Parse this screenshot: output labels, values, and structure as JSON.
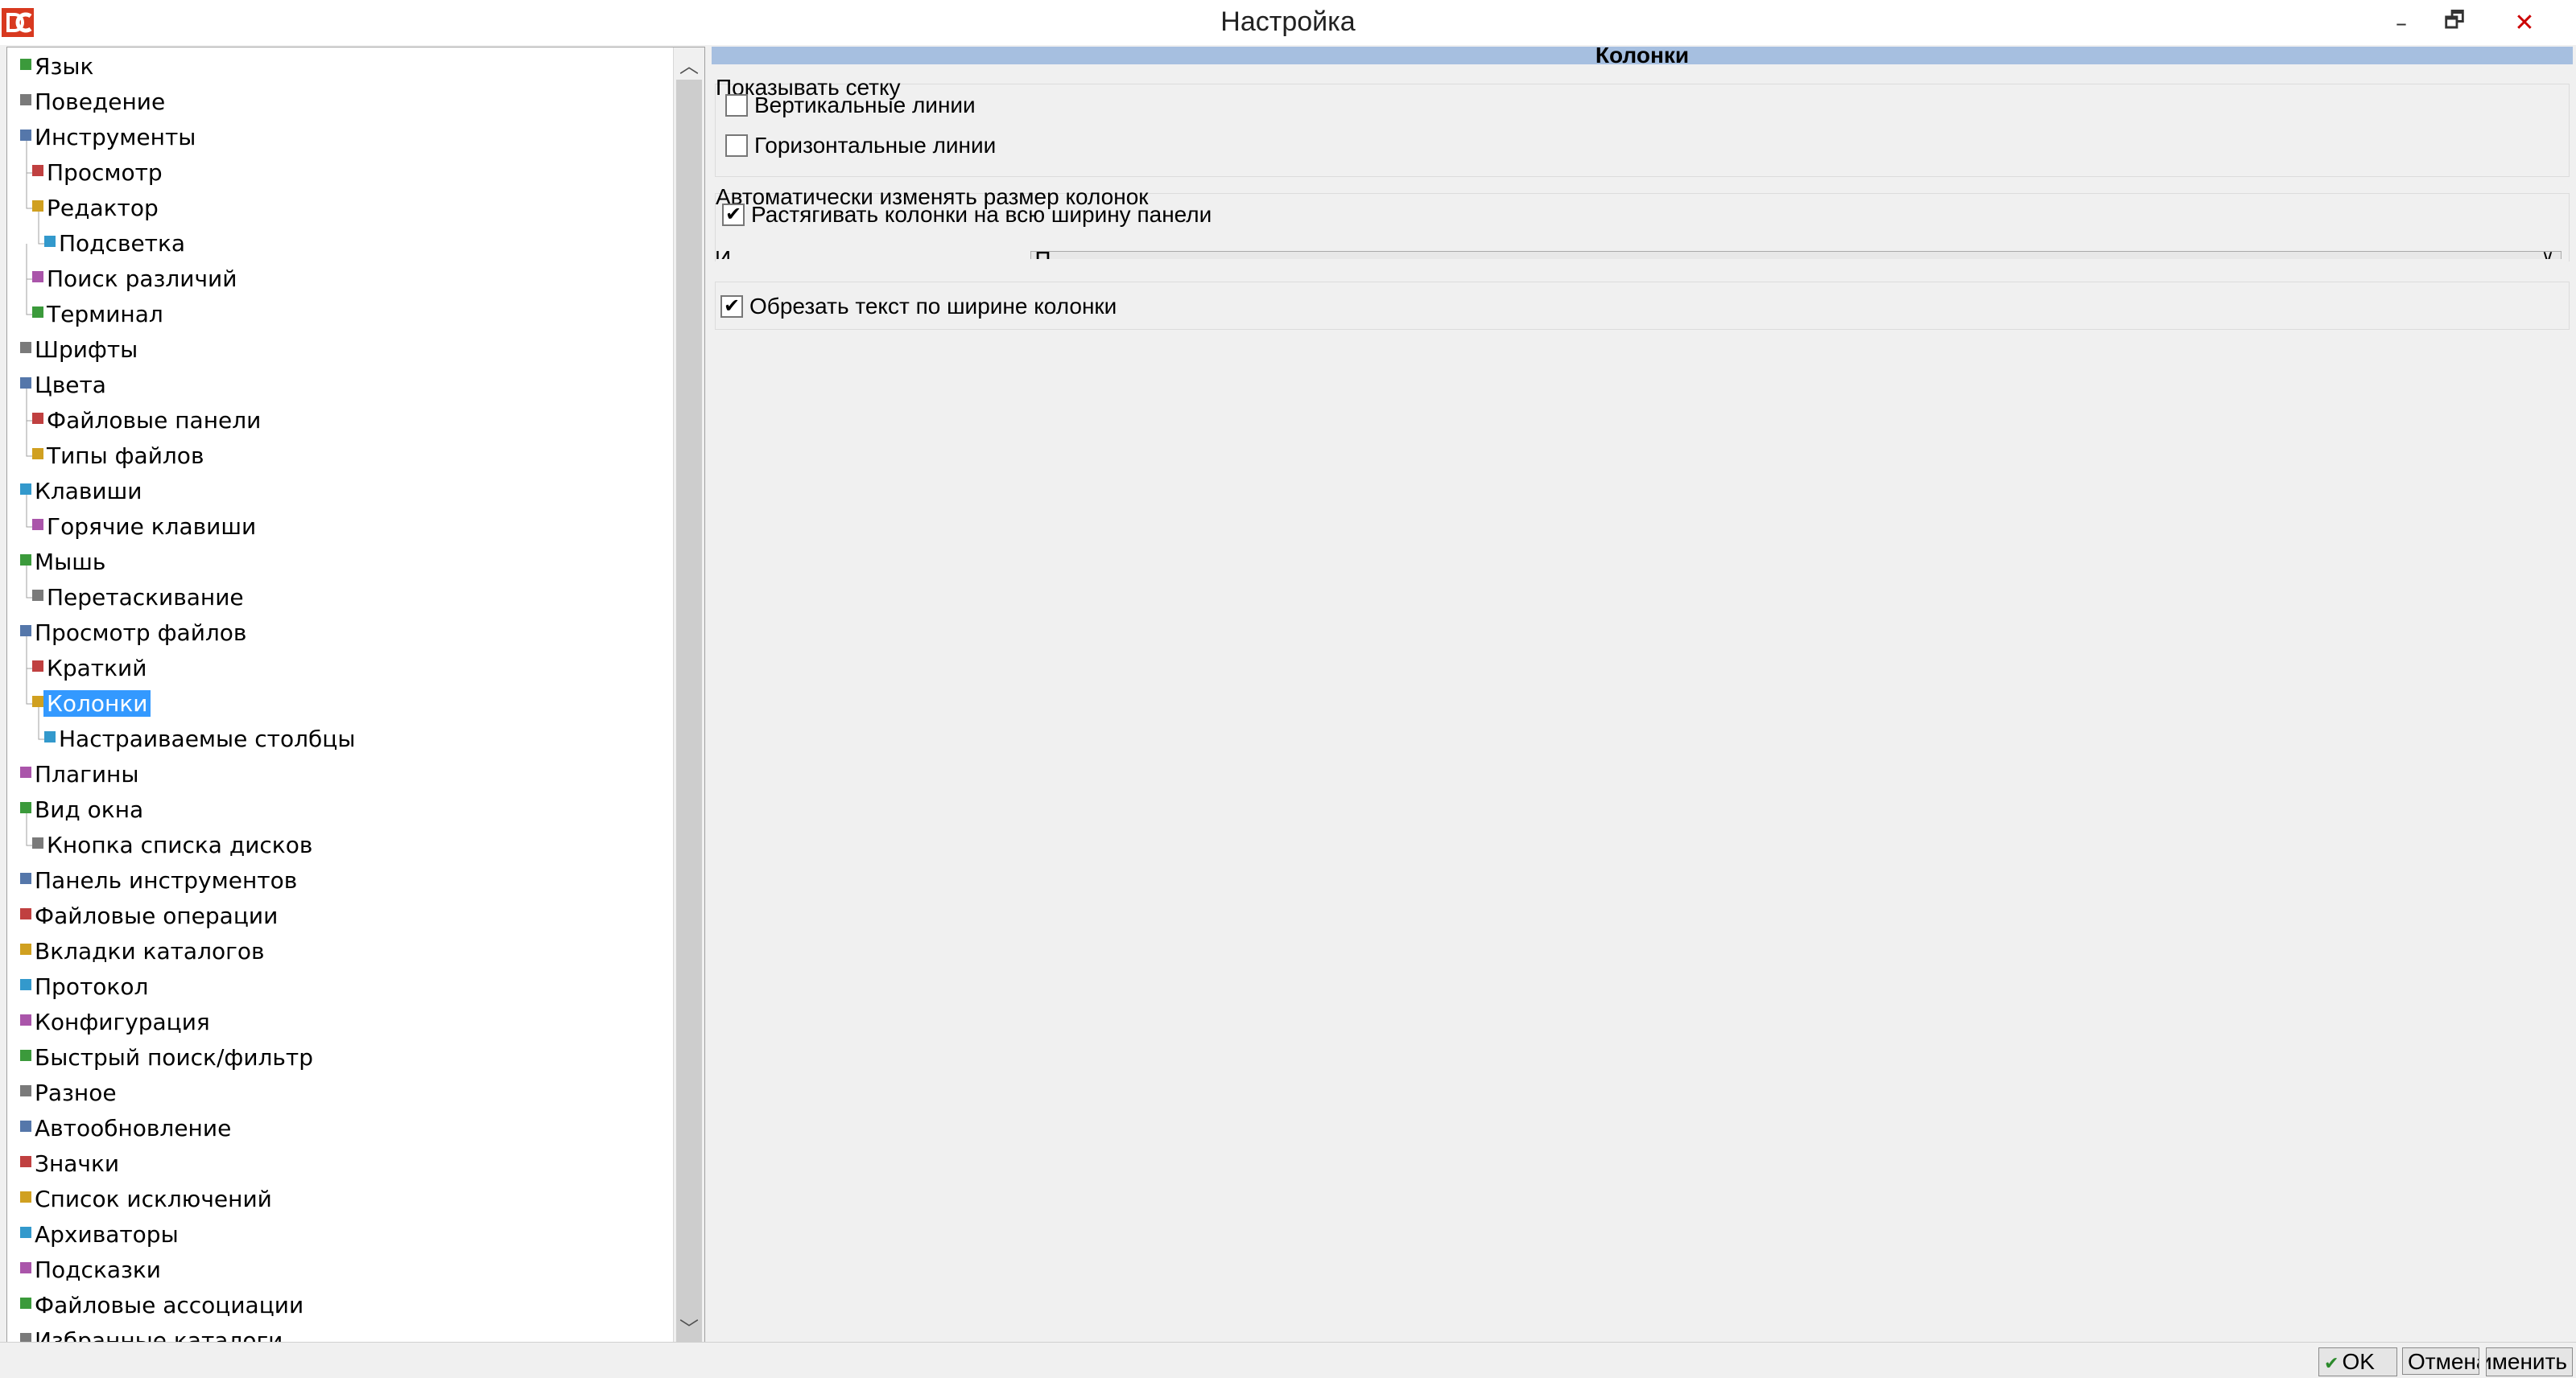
{
  "window": {
    "title": "Настройка",
    "minimize_glyph": "–",
    "restore_glyph": "🗗",
    "close_glyph": "✕"
  },
  "tree": {
    "selected": "Колонки",
    "items": [
      {
        "label": "Язык",
        "level": 0,
        "icon": "language-icon"
      },
      {
        "label": "Поведение",
        "level": 0,
        "icon": "behavior-icon"
      },
      {
        "label": "Инструменты",
        "level": 0,
        "icon": "tools-icon"
      },
      {
        "label": "Просмотр",
        "level": 1,
        "icon": "viewer-icon"
      },
      {
        "label": "Редактор",
        "level": 1,
        "icon": "editor-icon"
      },
      {
        "label": "Подсветка",
        "level": 2,
        "icon": "highlight-icon"
      },
      {
        "label": "Поиск различий",
        "level": 1,
        "icon": "diff-icon"
      },
      {
        "label": "Терминал",
        "level": 1,
        "icon": "terminal-icon"
      },
      {
        "label": "Шрифты",
        "level": 0,
        "icon": "fonts-icon"
      },
      {
        "label": "Цвета",
        "level": 0,
        "icon": "colors-icon"
      },
      {
        "label": "Файловые панели",
        "level": 1,
        "icon": "file-panels-icon"
      },
      {
        "label": "Типы файлов",
        "level": 1,
        "icon": "file-types-icon"
      },
      {
        "label": "Клавиши",
        "level": 0,
        "icon": "keys-icon"
      },
      {
        "label": "Горячие клавиши",
        "level": 1,
        "icon": "hotkeys-icon"
      },
      {
        "label": "Мышь",
        "level": 0,
        "icon": "mouse-icon"
      },
      {
        "label": "Перетаскивание",
        "level": 1,
        "icon": "drag-drop-icon"
      },
      {
        "label": "Просмотр файлов",
        "level": 0,
        "icon": "file-view-icon"
      },
      {
        "label": "Краткий",
        "level": 1,
        "icon": "brief-icon"
      },
      {
        "label": "Колонки",
        "level": 1,
        "icon": "columns-icon"
      },
      {
        "label": "Настраиваемые столбцы",
        "level": 2,
        "icon": "custom-columns-icon"
      },
      {
        "label": "Плагины",
        "level": 0,
        "icon": "plugins-icon"
      },
      {
        "label": "Вид окна",
        "level": 0,
        "icon": "layout-icon"
      },
      {
        "label": "Кнопка списка дисков",
        "level": 1,
        "icon": "drive-button-icon"
      },
      {
        "label": "Панель инструментов",
        "level": 0,
        "icon": "toolbar-icon"
      },
      {
        "label": "Файловые операции",
        "level": 0,
        "icon": "file-operations-icon"
      },
      {
        "label": "Вкладки каталогов",
        "level": 0,
        "icon": "folder-tabs-icon"
      },
      {
        "label": "Протокол",
        "level": 0,
        "icon": "log-icon"
      },
      {
        "label": "Конфигурация",
        "level": 0,
        "icon": "configuration-icon"
      },
      {
        "label": "Быстрый поиск/фильтр",
        "level": 0,
        "icon": "quick-search-icon"
      },
      {
        "label": "Разное",
        "level": 0,
        "icon": "misc-icon"
      },
      {
        "label": "Автообновление",
        "level": 0,
        "icon": "auto-refresh-icon"
      },
      {
        "label": "Значки",
        "level": 0,
        "icon": "icons-icon"
      },
      {
        "label": "Список исключений",
        "level": 0,
        "icon": "ignore-list-icon"
      },
      {
        "label": "Архиваторы",
        "level": 0,
        "icon": "archivers-icon"
      },
      {
        "label": "Подсказки",
        "level": 0,
        "icon": "tooltips-icon"
      },
      {
        "label": "Файловые ассоциации",
        "level": 0,
        "icon": "file-associations-icon"
      },
      {
        "label": "Избранные каталоги",
        "level": 0,
        "icon": "favorites-icon"
      }
    ]
  },
  "panel": {
    "title": "Колонки",
    "grid_group": {
      "legend": "Показывать сетку",
      "vertical": {
        "label": "Вертикальные линии",
        "checked": false
      },
      "horizontal": {
        "label": "Горизонтальные линии",
        "checked": false
      }
    },
    "autosize_group": {
      "legend": "Автоматически изменять размер колонок",
      "stretch": {
        "label": "Растягивать колонки на всю ширину панели",
        "checked": true
      },
      "cut_label": "И",
      "cut_combo_value": "П"
    },
    "truncate": {
      "label": "Обрезать текст по ширине колонки",
      "checked": true
    }
  },
  "buttons": {
    "ok": "OK",
    "cancel": "Отмена",
    "apply": "Применить"
  },
  "colors": {
    "selection": "#3399ff",
    "header_bar": "#a6bfe0",
    "close_red": "#c00000"
  }
}
